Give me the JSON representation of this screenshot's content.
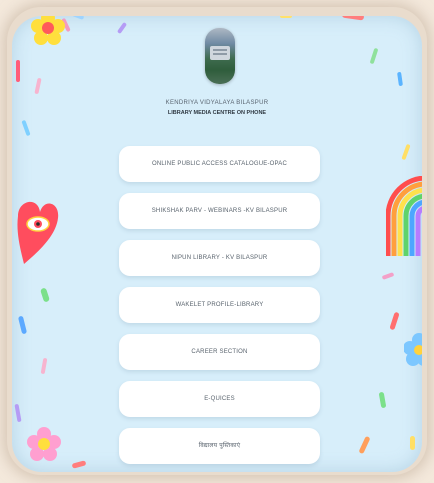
{
  "header": {
    "logo_icon": "school-building-photo",
    "school_name": "KENDRIYA VIDYALAYA BILASPUR",
    "subtitle": "LIBRARY MEDIA CENTRE ON PHONE"
  },
  "links": [
    {
      "label": "ONLINE PUBLIC ACCESS CATALOGUE-OPAC"
    },
    {
      "label": "SHIKSHAK PARV - WEBINARS -KV BILASPUR"
    },
    {
      "label": "NIPUN LIBRARY - KV BILASPUR"
    },
    {
      "label": "WAKELET PROFILE-LIBRARY"
    },
    {
      "label": "CAREER SECTION"
    },
    {
      "label": "E-QUICES"
    },
    {
      "label": "विद्यालय पुस्तिकाएं"
    }
  ],
  "decorations": {
    "left": [
      "heart-eye-icon"
    ],
    "right": [
      "rainbow-icon",
      "flower-icon"
    ],
    "corners": [
      "flower-icon",
      "flower-icon"
    ]
  },
  "colors": {
    "background": "#d7eefa",
    "button": "#ffffff",
    "outer": "#f4e9dc"
  }
}
